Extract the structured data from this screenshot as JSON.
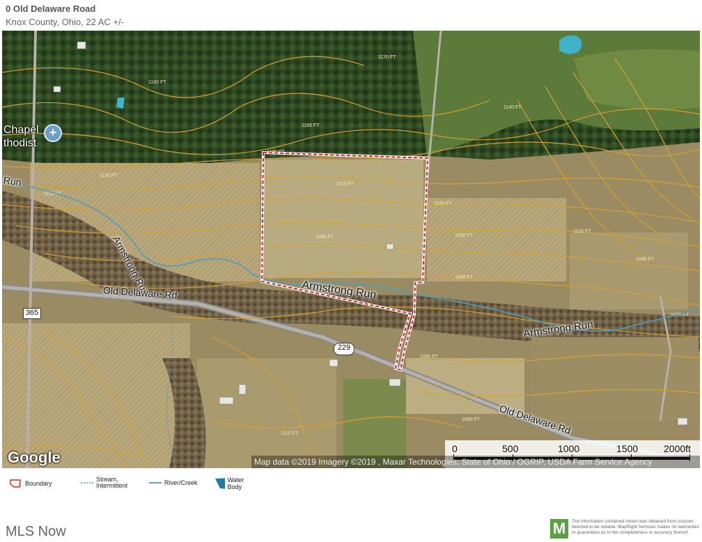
{
  "header": {
    "title": "0 Old Delaware Road",
    "subtitle": "Knox County, Ohio, 22 AC +/-"
  },
  "map": {
    "road_labels": [
      "Old Delaware Rd",
      "Old Delaware Rd"
    ],
    "stream_labels": [
      "Run",
      "Armstrong Run",
      "Armstrong Run",
      "Armstrong Run"
    ],
    "place_label": "Chapel\nthodist",
    "route_shields": [
      "365",
      "229"
    ],
    "contour_labels": [
      "1170 FT",
      "1160 FT",
      "1150 FT",
      "1140 FT",
      "1130 FT",
      "1120 FT",
      "1110 FT",
      "1100 FT",
      "1090 FT",
      "1080 FT",
      "1070 FT"
    ],
    "scale": {
      "labels": [
        "0",
        "500",
        "1000",
        "1500",
        "2000ft"
      ]
    },
    "google_logo": "Google",
    "attribution": "Map data ©2019 Imagery ©2019 , Maxar Technologies, State of Ohio / OGRIP, USDA Farm Service Agency",
    "colors": {
      "boundary": "#d4262a",
      "stream": "#4a9fc0",
      "water": "#3fb3c9",
      "contour": "#d6a12e"
    }
  },
  "legend": {
    "boundary": "Boundary",
    "stream": "Stream,\nIntermittent",
    "river": "River/Creek",
    "water": "Water Body"
  },
  "footer": {
    "mls": "MLS Now",
    "logo_letter": "M",
    "disclaimer": "The information contained herein was obtained from sources deemed to be reliable. MapRight Services makes no warranties or guarantees as to the completeness or accuracy thereof."
  }
}
